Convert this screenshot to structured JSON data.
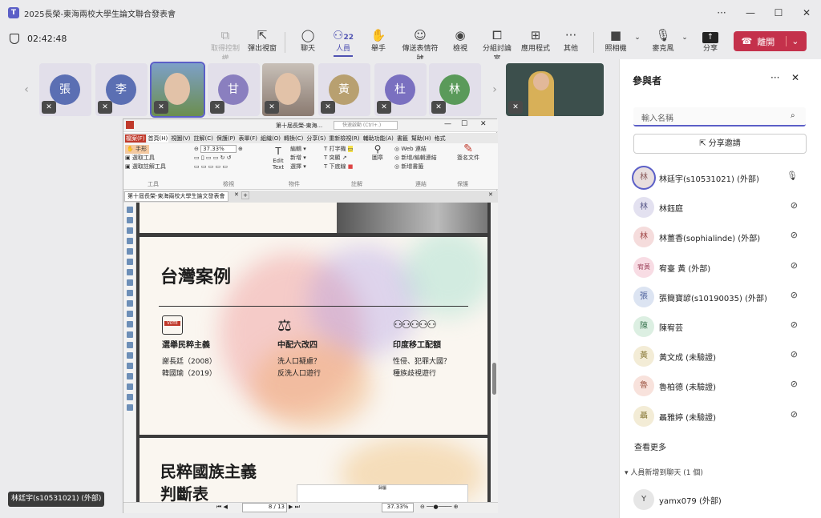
{
  "window": {
    "title": "2025長榮-東海兩校大學生論文聯合發表會",
    "app_logo": "T"
  },
  "meeting": {
    "timer": "02:42:48"
  },
  "toolbar": {
    "items": [
      {
        "label": "取得控制權",
        "icon": "screen-share-icon"
      },
      {
        "label": "彈出視窗",
        "icon": "popout-icon"
      },
      {
        "label": "聊天",
        "icon": "chat-icon"
      },
      {
        "label": "人員",
        "icon": "people-icon",
        "count": "22"
      },
      {
        "label": "舉手",
        "icon": "raise-hand-icon"
      },
      {
        "label": "傳送表情符號",
        "icon": "emoji-icon"
      },
      {
        "label": "檢視",
        "icon": "view-icon"
      },
      {
        "label": "分組討論室",
        "icon": "breakout-icon"
      },
      {
        "label": "應用程式",
        "icon": "add-app-icon"
      },
      {
        "label": "其他",
        "icon": "more-icon"
      },
      {
        "label": "照相機",
        "icon": "camera-icon"
      },
      {
        "label": "麥克風",
        "icon": "mic-off-icon"
      },
      {
        "label": "分享",
        "icon": "share-icon"
      }
    ],
    "leave_label": "離開"
  },
  "gallery": [
    {
      "initial": "張",
      "color": "#5b6fb3"
    },
    {
      "initial": "李",
      "color": "#5b6fb3"
    },
    {
      "initial": "",
      "color": "#6b8e4e",
      "video": true
    },
    {
      "initial": "甘",
      "color": "#8a7fbf"
    },
    {
      "initial": "",
      "color": "#8a6a5a",
      "video": true
    },
    {
      "initial": "黃",
      "color": "#b8a070"
    },
    {
      "initial": "杜",
      "color": "#7a70c0"
    },
    {
      "initial": "林",
      "color": "#5a9a5a"
    }
  ],
  "pdf": {
    "title_bar": "第十屆長榮-東海...",
    "search_placeholder": "快速啟動 (Ctrl+.)",
    "tabs": [
      "檔案(F)",
      "首頁(H)",
      "視圖(V)",
      "註解(C)",
      "保護(P)",
      "表單(F)",
      "組織(O)",
      "轉換(C)",
      "分享(S)",
      "重新檢視(R)",
      "輔助功能(A)",
      "書籤",
      "幫助(H)",
      "格式"
    ],
    "ribbon": {
      "hand": "手形",
      "select_tool": "選取工具",
      "select_annot": "選取註解工具",
      "zoom": "37.33%",
      "edit_text": "Edit Text",
      "edit": "編輯",
      "add": "新增",
      "select": "選擇",
      "typewriter": "打字機",
      "highlight": "突顯",
      "underline": "下底線",
      "image": "圖章",
      "web_link": "Web 連結",
      "new_edit_link": "新增/編輯連結",
      "new_bookmark": "新增書籤",
      "signed_doc": "簽名文件",
      "groups": [
        "工具",
        "檢視",
        "物件",
        "註解",
        "連結",
        "保護"
      ]
    },
    "doc_tab": "第十屆長榮-東海兩校大學生論文發表會",
    "page_info": "8 / 13",
    "zoom_status": "37.33%",
    "slide": {
      "title": "台灣案例",
      "columns": [
        {
          "heading": "選舉民粹主義",
          "lines": [
            "謝長廷（2008）",
            "韓國瑜（2019）"
          ],
          "icon": "ballot-box-icon",
          "icon_text": "VOTE"
        },
        {
          "heading": "中配六改四",
          "lines": [
            "洗人口疑慮？",
            "反洗人口遊行"
          ],
          "icon": "scales-icon"
        },
        {
          "heading": "印度移工配額",
          "lines": [
            "性侵、犯罪大國？",
            "種族歧視遊行"
          ],
          "icon": "crowd-icon"
        }
      ]
    },
    "slide2": {
      "title_lines": [
        "民粹國族主義",
        "判斷表"
      ],
      "mini_label": "歸屬"
    }
  },
  "speaker_chip": "林廷宇(s10531021) (外部)",
  "participants": {
    "header": "參與者",
    "search_placeholder": "輸入名稱",
    "invite_label": "分享邀請",
    "people": [
      {
        "name": "林廷宇(s10531021) (外部)",
        "initial": "林",
        "bg": "#e8dede",
        "fg": "#8a5a5a",
        "mic": "on"
      },
      {
        "name": "林鈺庭",
        "initial": "林",
        "bg": "#e3e1f0",
        "fg": "#5a5a8a",
        "mic": "off"
      },
      {
        "name": "林薑香(sophialinde) (外部)",
        "initial": "林",
        "bg": "#f5dcdc",
        "fg": "#a04848",
        "mic": "off"
      },
      {
        "name": "宥臺 黃 (外部)",
        "initial": "宥黃",
        "bg": "#f8dce4",
        "fg": "#a04860",
        "mic": "off"
      },
      {
        "name": "張簡寶諺(s10190035) (外部)",
        "initial": "張",
        "bg": "#dce4f2",
        "fg": "#4a5e9a",
        "mic": "off"
      },
      {
        "name": "陳宥芸",
        "initial": "陳",
        "bg": "#dcefe2",
        "fg": "#3f7a55",
        "mic": "off"
      },
      {
        "name": "黃文成 (未驗證)",
        "initial": "黃",
        "bg": "#f3ecd6",
        "fg": "#8a7a3a",
        "mic": "off"
      },
      {
        "name": "魯柏德 (未驗證)",
        "initial": "魯",
        "bg": "#f8e2dc",
        "fg": "#a05a48",
        "mic": "off"
      },
      {
        "name": "聶雅婷 (未驗證)",
        "initial": "聶",
        "bg": "#f3ecd6",
        "fg": "#8a7a3a",
        "mic": "off"
      }
    ],
    "see_more": "查看更多",
    "added_section": "人員新增到聊天 (1 個)",
    "added": [
      {
        "name": "yamx079 (外部)",
        "initial": "Y",
        "bg": "#e6e6e6",
        "fg": "#444"
      }
    ]
  }
}
